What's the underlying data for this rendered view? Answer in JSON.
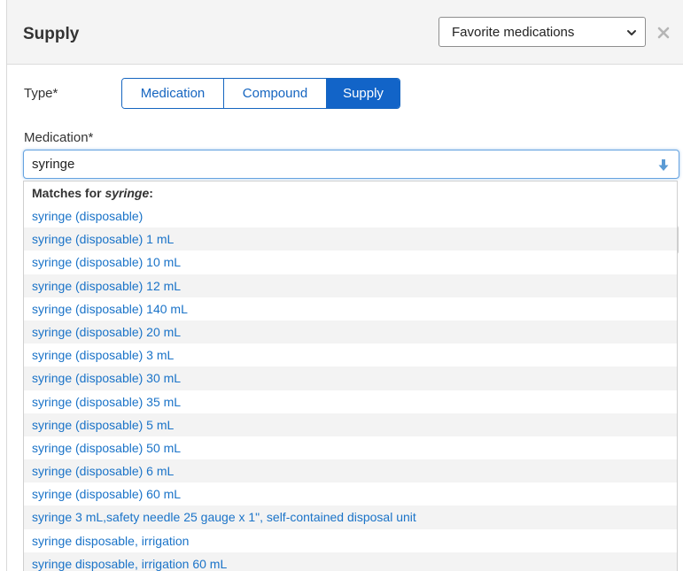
{
  "header": {
    "title": "Supply",
    "favorites_select": {
      "value": "Favorite medications",
      "icon": "chevron-down-icon"
    },
    "close_icon": "close-icon"
  },
  "type_field": {
    "label": "Type*",
    "options": [
      "Medication",
      "Compound",
      "Supply"
    ],
    "selected": "Supply",
    "accent_color": "#1264c8"
  },
  "medication_field": {
    "label": "Medication*",
    "value": "syringe",
    "icon": "arrow-down-icon"
  },
  "dropdown": {
    "header_prefix": "Matches for ",
    "header_query": "syringe",
    "header_suffix": ":",
    "items": [
      "syringe (disposable)",
      "syringe (disposable) 1 mL",
      "syringe (disposable) 10 mL",
      "syringe (disposable) 12 mL",
      "syringe (disposable) 140 mL",
      "syringe (disposable) 20 mL",
      "syringe (disposable) 3 mL",
      "syringe (disposable) 30 mL",
      "syringe (disposable) 35 mL",
      "syringe (disposable) 5 mL",
      "syringe (disposable) 50 mL",
      "syringe (disposable) 6 mL",
      "syringe (disposable) 60 mL",
      "syringe 3 mL,safety needle 25 gauge x 1\", self-contained disposal unit",
      "syringe disposable, irrigation",
      "syringe disposable, irrigation 60 mL"
    ],
    "link_color": "#1a73c8"
  }
}
